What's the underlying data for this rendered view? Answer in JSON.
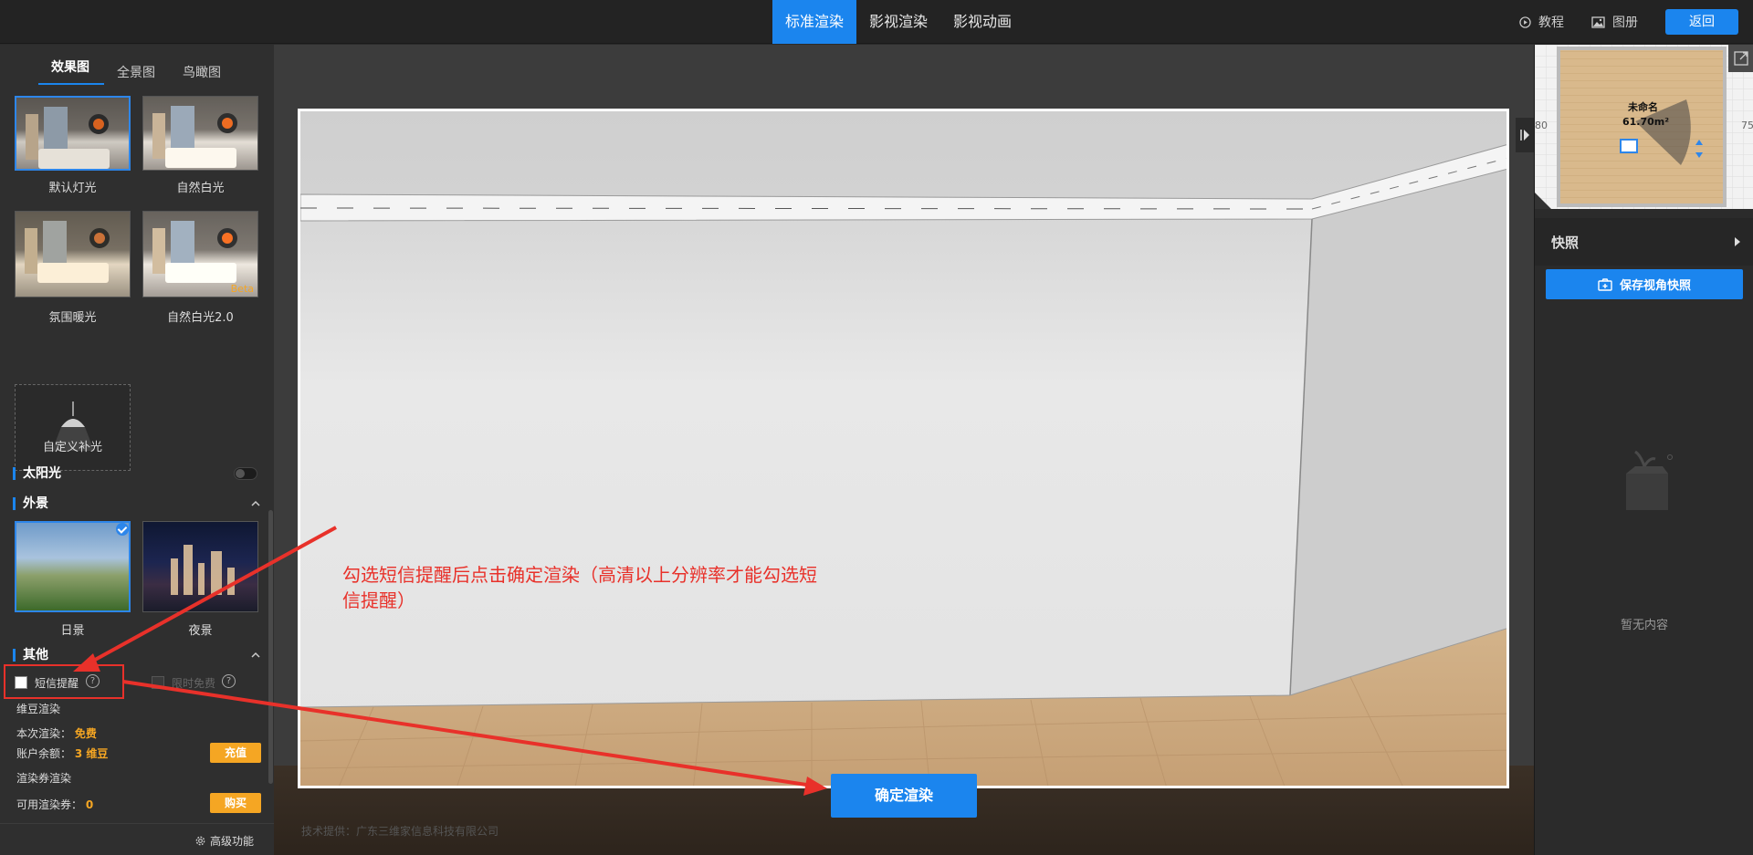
{
  "header": {
    "tabs": [
      {
        "label": "标准渲染",
        "active": true
      },
      {
        "label": "影视渲染",
        "active": false
      },
      {
        "label": "影视动画",
        "active": false
      }
    ],
    "tutorial": "教程",
    "album": "图册",
    "return": "返回"
  },
  "left": {
    "tabs": [
      "效果图",
      "全景图",
      "鸟瞰图"
    ],
    "lighting": [
      {
        "label": "默认灯光",
        "selected": true
      },
      {
        "label": "自然白光",
        "selected": false
      },
      {
        "label": "氛围暖光",
        "selected": false
      },
      {
        "label": "自然白光2.0",
        "selected": false,
        "badge": "Beta"
      }
    ],
    "custom_light": "自定义补光",
    "sunlight": "太阳光",
    "sunlight_on": false,
    "scenery_title": "外景",
    "scenery": [
      {
        "label": "日景",
        "selected": true
      },
      {
        "label": "夜景",
        "selected": false
      }
    ],
    "other_title": "其他",
    "sms_reminder": "短信提醒",
    "limited_free": "限时免费",
    "help_glyph": "?",
    "weidou_title": "维豆渲染",
    "current_render_label": "本次渲染：",
    "current_render_value": "免费",
    "balance_label": "账户余额：",
    "balance_value": "3 维豆",
    "recharge": "充值",
    "voucher_title": "渲染券渲染",
    "voucher_label": "可用渲染券：",
    "voucher_value": "0",
    "buy": "购买",
    "advanced": "高级功能"
  },
  "viewport": {
    "annotation": "勾选短信提醒后点击确定渲染（高清以上分辨率才能勾选短信提醒）",
    "confirm": "确定渲染",
    "credit": "技术提供：广东三维家信息科技有限公司"
  },
  "right": {
    "room_name": "未命名",
    "room_area": "61.70m²",
    "ruler_left": "80",
    "ruler_right": "75",
    "snapshot_title": "快照",
    "save_snapshot": "保存视角快照",
    "empty": "暂无内容"
  },
  "colors": {
    "accent": "#1b85ee",
    "orange": "#f5a623",
    "annotation_red": "#e8312a"
  }
}
